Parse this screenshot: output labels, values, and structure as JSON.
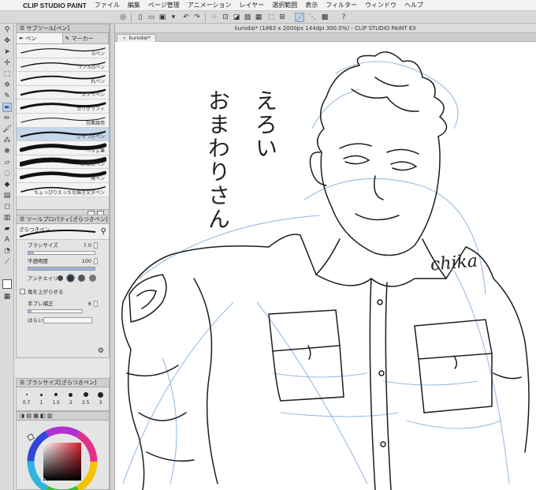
{
  "menubar": {
    "app_name": "CLIP STUDIO PAINT",
    "items": [
      "ファイル",
      "編集",
      "ページ管理",
      "アニメーション",
      "レイヤー",
      "選択範囲",
      "表示",
      "フィルター",
      "ウィンドウ",
      "ヘルプ"
    ]
  },
  "window": {
    "title": "kurodai* (1863 x 2000px 144dpi 300.0%) - CLIP STUDIO PAINT EX"
  },
  "document_tab": {
    "label": "kurodai*"
  },
  "subtool_panel": {
    "title": "サブツール[ペン]",
    "tabs": [
      "ペン",
      "マーカー"
    ],
    "brushes": [
      "Gペン",
      "リアルGペン",
      "丸ペン",
      "カブラペン",
      "カリグラフィ",
      "効果線用",
      "ざらつきペン",
      "べちょ筆",
      "ベタ修正ペン",
      "角ペン",
      "ちょっぴりえっちな描き文字ペン"
    ],
    "selected_brush": "ざらつきペン"
  },
  "tool_property": {
    "title": "ツールプロパティ[ざらつきペン]",
    "brush_name": "ざらつきペン",
    "brush_size_label": "ブラシサイズ",
    "brush_size_value": "7.0",
    "brush_size_level": 0.08,
    "opacity_label": "不透明度",
    "opacity_value": "100",
    "opacity_level": 1.0,
    "antialias_label": "アンチエイリ",
    "corner_label": "角を上がらせる",
    "stabilization_label": "手ブレ補正",
    "stabilization_value": "6",
    "sweep_label": "はらい"
  },
  "brush_size_panel": {
    "title": "ブラシサイズ[ざらつきペン]",
    "sizes": [
      "0.7",
      "1",
      "1.5",
      "2",
      "2.5",
      "3"
    ]
  },
  "canvas": {
    "japanese_text_col1": "えろい",
    "japanese_text_col2": "おまわりさん",
    "signature": "chika"
  },
  "colors": {
    "selection": "#c6d7ea",
    "sketch_blue": "#8fb4e0",
    "ink": "#1c1c1c"
  }
}
